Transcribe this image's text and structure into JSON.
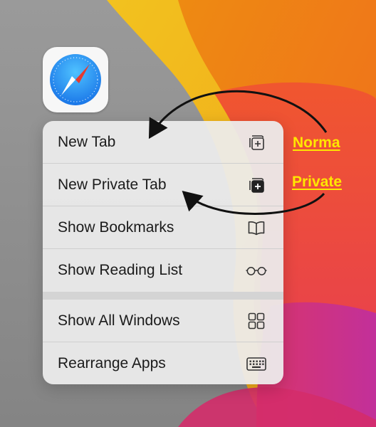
{
  "menu": {
    "items": [
      {
        "label": "New Tab",
        "icon": "new-tab-icon"
      },
      {
        "label": "New Private Tab",
        "icon": "new-private-tab-icon"
      },
      {
        "label": "Show Bookmarks",
        "icon": "book-icon"
      },
      {
        "label": "Show Reading List",
        "icon": "glasses-icon"
      },
      {
        "label": "Show All Windows",
        "icon": "grid-icon"
      },
      {
        "label": "Rearrange Apps",
        "icon": "keyboard-icon"
      }
    ]
  },
  "annotations": {
    "normal": "Norma",
    "private": "Private"
  },
  "colors": {
    "annotation": "#ffe600",
    "safari_blue": "#1e8ef0",
    "compass_red": "#e63a2f"
  }
}
